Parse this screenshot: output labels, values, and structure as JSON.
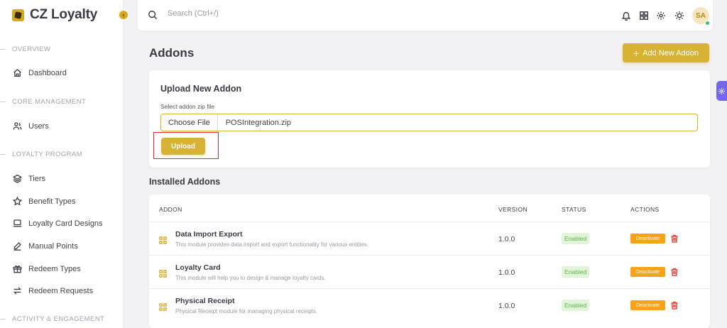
{
  "brand": {
    "name": "CZ Loyalty"
  },
  "sidebar": {
    "sections": [
      {
        "title": "OVERVIEW"
      },
      {
        "title": "CORE MANAGEMENT"
      },
      {
        "title": "LOYALTY PROGRAM"
      },
      {
        "title": "ACTIVITY & ENGAGEMENT"
      }
    ],
    "items": [
      {
        "label": "Dashboard",
        "icon": "home-icon"
      },
      {
        "label": "Users",
        "icon": "users-icon"
      },
      {
        "label": "Tiers",
        "icon": "layers-icon"
      },
      {
        "label": "Benefit Types",
        "icon": "star-icon"
      },
      {
        "label": "Loyalty Card Designs",
        "icon": "laptop-icon"
      },
      {
        "label": "Manual Points",
        "icon": "pen-icon"
      },
      {
        "label": "Redeem Types",
        "icon": "gift-icon"
      },
      {
        "label": "Redeem Requests",
        "icon": "swap-icon"
      }
    ]
  },
  "topbar": {
    "search_placeholder": "Search (Ctrl+/)",
    "avatar_initials": "SA"
  },
  "page": {
    "title": "Addons",
    "add_button": "Add New Addon"
  },
  "upload": {
    "title": "Upload New Addon",
    "field_label": "Select addon zip file",
    "choose_file_label": "Choose File",
    "file_name": "POSIntegration.zip",
    "upload_button": "Upload"
  },
  "installed": {
    "title": "Installed Addons",
    "columns": [
      "ADDON",
      "VERSION",
      "STATUS",
      "ACTIONS"
    ],
    "rows": [
      {
        "name": "Data Import Export",
        "description": "This module provides data import and export functionality for various entities.",
        "version": "1.0.0",
        "status": "Enabled",
        "action": "Deactivate"
      },
      {
        "name": "Loyalty Card",
        "description": "This module will help you to design & manage loyalty cards.",
        "version": "1.0.0",
        "status": "Enabled",
        "action": "Deactivate"
      },
      {
        "name": "Physical Receipt",
        "description": "Physical Receipt module for managing physical receipts.",
        "version": "1.0.0",
        "status": "Enabled",
        "action": "Deactivate"
      }
    ]
  },
  "colors": {
    "accent": "#d8b232",
    "status_enabled": "#5bb34d",
    "deactivate": "#f5a31b",
    "danger": "#e34b3c",
    "customizer": "#7367f0"
  }
}
